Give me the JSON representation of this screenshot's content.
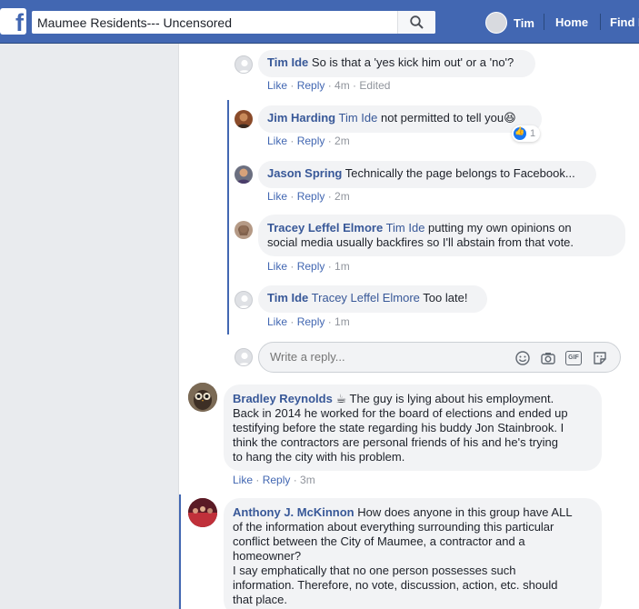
{
  "header": {
    "logo_letter": "f",
    "search_value": "Maumee Residents--- Uncensored",
    "user_name": "Tim",
    "nav_home": "Home",
    "nav_find": "Find F"
  },
  "colors": {
    "brand": "#4267b2",
    "link": "#385898",
    "bubble": "#f2f3f5",
    "muted": "#90949c"
  },
  "comments": [
    {
      "author": "Tim Ide",
      "mention": "",
      "text": "So is that a 'yes kick him out' or a 'no'?",
      "like": "Like",
      "reply": "Reply",
      "time": "4m",
      "extra": "Edited"
    },
    {
      "author": "Jim Harding",
      "mention": "Tim Ide",
      "text": "not permitted to tell you😆",
      "like": "Like",
      "reply": "Reply",
      "time": "2m",
      "reaction_count": "1"
    },
    {
      "author": "Jason Spring",
      "mention": "",
      "text": "Technically the page belongs to Facebook...",
      "like": "Like",
      "reply": "Reply",
      "time": "2m"
    },
    {
      "author": "Tracey Leffel Elmore",
      "mention": "Tim Ide",
      "text_line1": "putting my own opinions on",
      "text_line2": "social media usually backfires so I'll abstain from that vote.",
      "like": "Like",
      "reply": "Reply",
      "time": "1m"
    },
    {
      "author": "Tim Ide",
      "mention": "Tracey Leffel Elmore",
      "text": "Too late!",
      "like": "Like",
      "reply": "Reply",
      "time": "1m"
    },
    {
      "author": "Bradley Reynolds",
      "badge": "☕",
      "lines": [
        "The guy is lying about his employment.",
        "Back in 2014 he worked for the board of elections and ended up",
        "testifying before the state regarding his buddy Jon Stainbrook. I",
        "think the contractors are personal friends of his and he's trying",
        "to hang the city with his problem."
      ],
      "like": "Like",
      "reply": "Reply",
      "time": "3m"
    },
    {
      "author": "Anthony J. McKinnon",
      "lines": [
        "How does anyone in this group have ALL",
        "of the information about everything surrounding this particular",
        "conflict between the City of Maumee, a contractor and a",
        "homeowner?",
        "I say emphatically that no one person possesses such",
        "information. Therefore, no vote, discussion, action, etc. should",
        "that place."
      ]
    }
  ],
  "reply_box": {
    "placeholder": "Write a reply...",
    "icons": [
      "emoji-icon",
      "camera-icon",
      "gif-icon",
      "sticker-icon"
    ],
    "gif_label": "GIF"
  }
}
